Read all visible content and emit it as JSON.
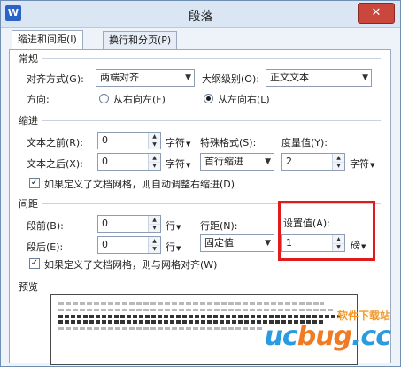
{
  "window": {
    "app_icon_letter": "W",
    "title": "段落",
    "close_glyph": "✕"
  },
  "tabs": [
    {
      "label": "缩进和间距(I)",
      "active": true
    },
    {
      "label": "换行和分页(P)",
      "active": false
    }
  ],
  "general": {
    "section_label": "常规",
    "alignment_label": "对齐方式(G):",
    "alignment_value": "两端对齐",
    "outline_label": "大纲级别(O):",
    "outline_value": "正文文本",
    "direction_label": "方向:",
    "rtl_label": "从右向左(F)",
    "ltr_label": "从左向右(L)",
    "direction_selected": "ltr"
  },
  "indent": {
    "section_label": "缩进",
    "before_label": "文本之前(R):",
    "before_value": "0",
    "before_unit": "字符",
    "after_label": "文本之后(X):",
    "after_value": "0",
    "after_unit": "字符",
    "special_label": "特殊格式(S):",
    "special_value": "首行缩进",
    "measure_label": "度量值(Y):",
    "measure_value": "2",
    "measure_unit": "字符",
    "auto_adjust_label": "如果定义了文档网格，则自动调整右缩进(D)",
    "auto_adjust_checked": true
  },
  "spacing": {
    "section_label": "间距",
    "before_label": "段前(B):",
    "before_value": "0",
    "before_unit": "行",
    "after_label": "段后(E):",
    "after_value": "0",
    "after_unit": "行",
    "line_label": "行距(N):",
    "line_value": "固定值",
    "setting_label": "设置值(A):",
    "setting_value": "1",
    "setting_unit": "磅",
    "grid_align_label": "如果定义了文档网格，则与网格对齐(W)",
    "grid_align_checked": true
  },
  "preview": {
    "section_label": "预览"
  },
  "watermark": {
    "top": "软件下载站",
    "main_a": "uc",
    "main_b": "bug",
    "main_c": ".cc"
  },
  "colors": {
    "highlight": "#e01b1b",
    "close_button": "#c9473c"
  },
  "icons": {
    "spin_up": "▲",
    "spin_down": "▼",
    "dropdown": "▼",
    "check": "✓"
  }
}
